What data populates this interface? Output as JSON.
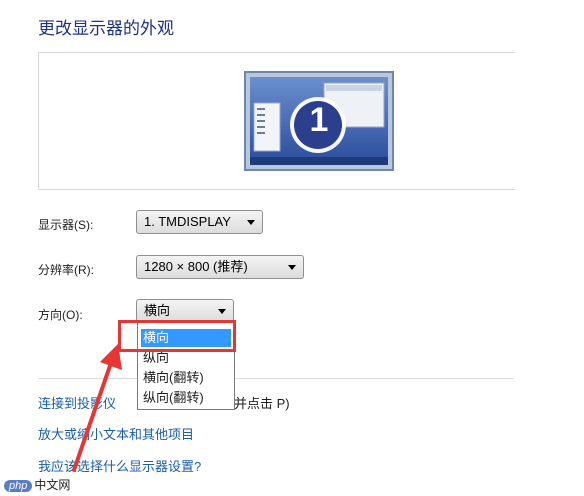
{
  "page": {
    "title": "更改显示器的外观"
  },
  "preview": {
    "monitor_number": "1",
    "icon": "monitor-1-icon"
  },
  "form": {
    "display": {
      "label": "显示器(S):",
      "value": "1. TMDISPLAY"
    },
    "resolution": {
      "label": "分辨率(R):",
      "value": "1280 × 800 (推荐)"
    },
    "orientation": {
      "label": "方向(O):",
      "value": "横向",
      "options": [
        "横向",
        "纵向",
        "横向(翻转)",
        "纵向(翻转)"
      ],
      "highlighted": "横向"
    }
  },
  "links": {
    "projector_visible": "连接到投影仪",
    "projector_suffix": "并点击 P)",
    "text_size": "放大或缩小文本和其他项目",
    "which_settings": "我应该选择什么显示器设置?"
  },
  "watermark": {
    "badge": "php",
    "text": "中文网"
  },
  "colors": {
    "annotation_red": "#e53535",
    "highlight": "#3399ff",
    "link": "#1a5ea8",
    "title": "#1e3287"
  }
}
